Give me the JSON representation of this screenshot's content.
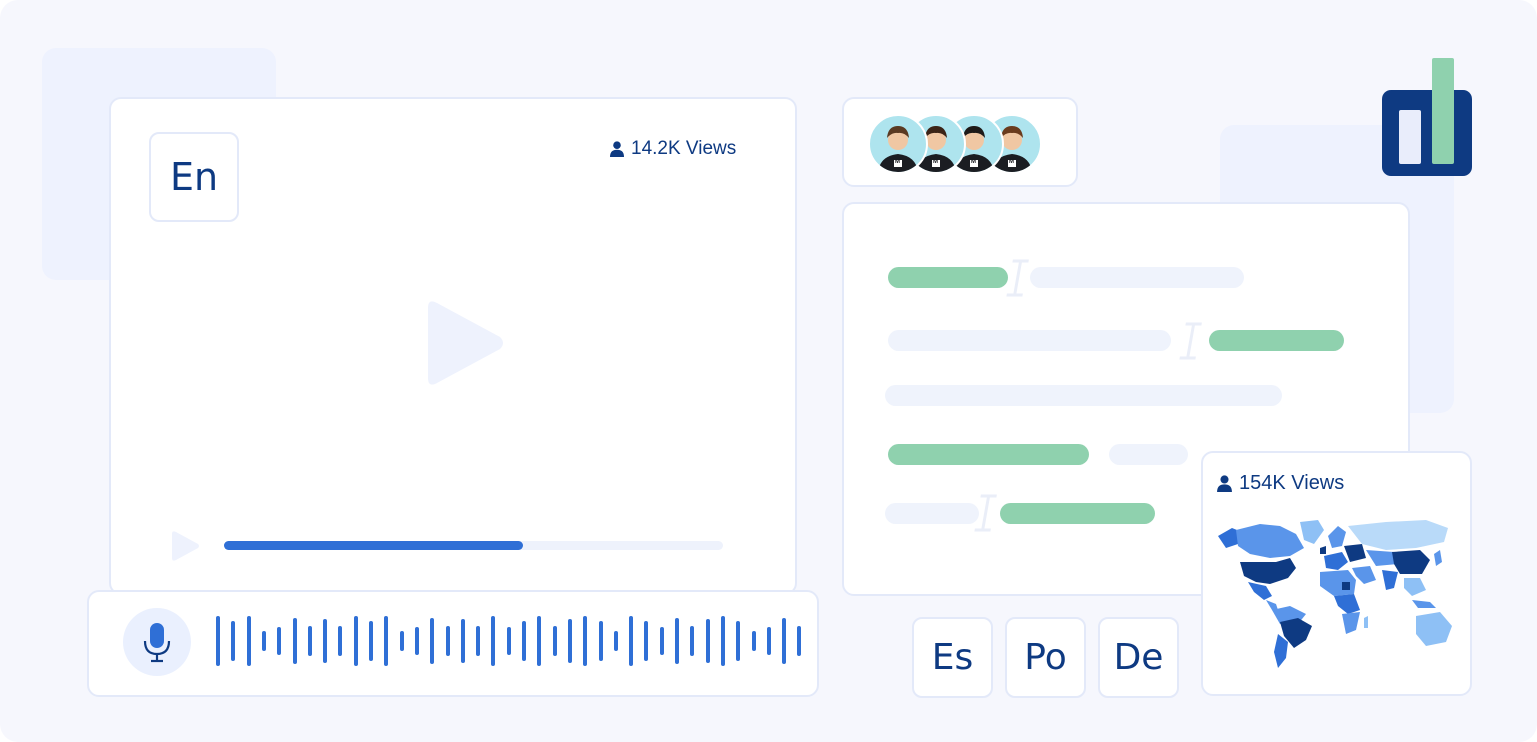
{
  "left_player": {
    "language_badge": "En",
    "views_label": "14.2K Views",
    "progress_fraction": 0.6
  },
  "transcript_panel": {
    "lines": [
      {
        "segments": [
          {
            "kind": "green"
          },
          {
            "kind": "cursor"
          },
          {
            "kind": "grey"
          }
        ]
      },
      {
        "segments": [
          {
            "kind": "grey"
          },
          {
            "kind": "cursor"
          },
          {
            "kind": "green"
          }
        ]
      },
      {
        "segments": [
          {
            "kind": "grey"
          }
        ]
      },
      {
        "segments": [
          {
            "kind": "green"
          },
          {
            "kind": "grey"
          }
        ]
      },
      {
        "segments": [
          {
            "kind": "grey"
          },
          {
            "kind": "cursor"
          },
          {
            "kind": "green"
          }
        ]
      }
    ]
  },
  "target_languages": [
    "Es",
    "Po",
    "De"
  ],
  "map_card": {
    "views_label": "154K Views"
  },
  "avatars": {
    "count": 4,
    "shirt_letter": "M"
  },
  "colors": {
    "accent_blue": "#2f6fd6",
    "dark_navy": "#0e3a82",
    "mint_green": "#8fd1ae",
    "light_blue": "#eef2fe"
  },
  "icons": {
    "play": "play-icon",
    "mic": "microphone-icon",
    "person": "person-icon",
    "text_cursor": "text-cursor-icon",
    "logo": "bar-chart-logo"
  }
}
